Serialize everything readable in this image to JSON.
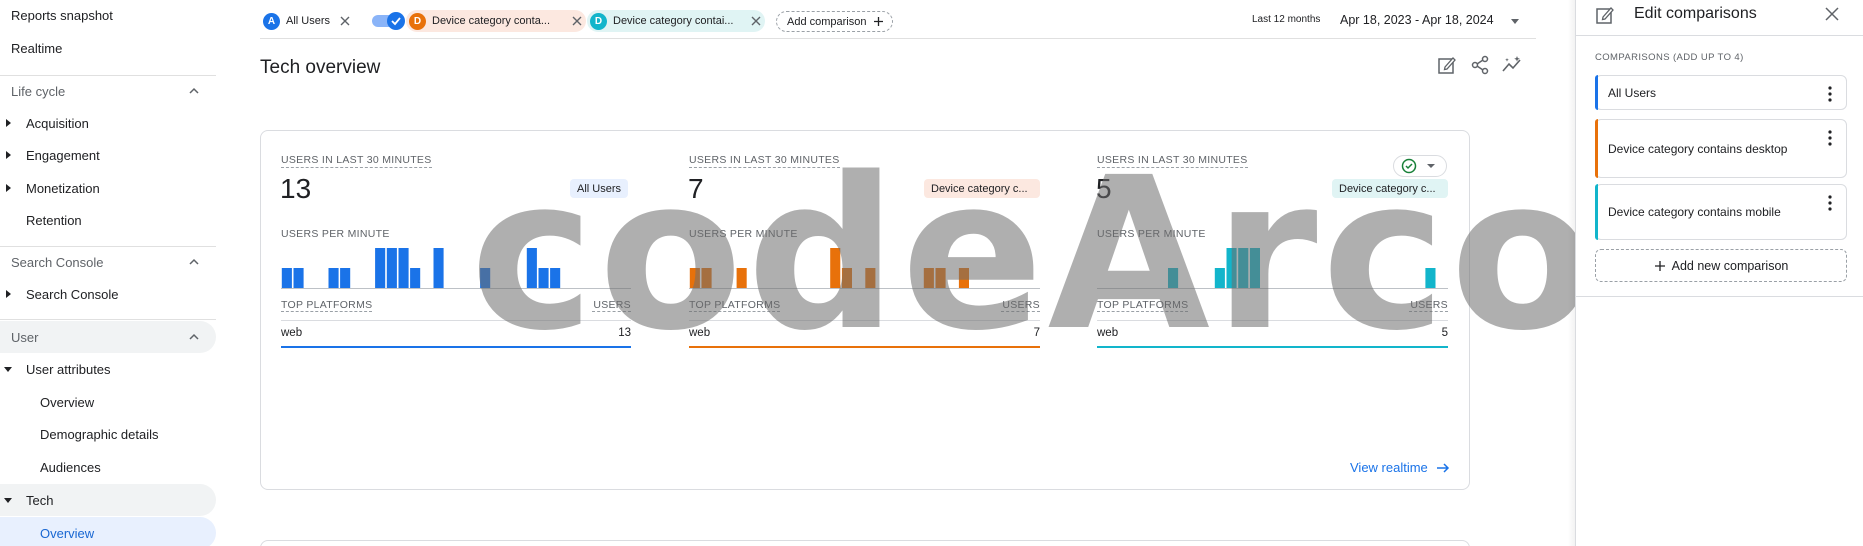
{
  "sidebar": {
    "top_items": [
      "Reports snapshot",
      "Realtime"
    ],
    "life_cycle": {
      "title": "Life cycle",
      "items": [
        "Acquisition",
        "Engagement",
        "Monetization",
        "Retention"
      ]
    },
    "search_console": {
      "title": "Search Console",
      "items": [
        "Search Console"
      ]
    },
    "user": {
      "title": "User",
      "user_attributes": "User attributes",
      "user_attributes_items": [
        "Overview",
        "Demographic details",
        "Audiences"
      ],
      "tech": "Tech",
      "tech_items": [
        "Overview"
      ]
    }
  },
  "topbar": {
    "chips": [
      {
        "badge": "A",
        "label": "All Users",
        "color": "#1a73e8"
      },
      {
        "badge": "D",
        "label": "Device category conta...",
        "color": "#e8710a"
      },
      {
        "badge": "D",
        "label": "Device category contai...",
        "color": "#12b5cb"
      }
    ],
    "add_comparison": "Add comparison",
    "date_label": "Last 12 months",
    "date_range": "Apr 18, 2023 - Apr 18, 2024"
  },
  "page": {
    "title": "Tech overview"
  },
  "card": {
    "columns": [
      {
        "label": "USERS IN LAST 30 MINUTES",
        "value": "13",
        "segment": "All Users",
        "segment_bg": "#e8f0fe",
        "segment_fg": "#202124",
        "color": "#1a73e8",
        "per_minute": "USERS PER MINUTE",
        "bars": [
          1,
          1,
          0,
          0,
          1,
          1,
          0,
          0,
          2,
          2,
          2,
          1,
          0,
          2,
          0,
          0,
          0,
          1,
          0,
          0,
          0,
          2,
          1,
          1,
          0,
          0,
          0,
          0,
          0,
          0
        ],
        "platforms_header": "TOP PLATFORMS",
        "users_header": "USERS",
        "platform": "web",
        "platform_value": "13"
      },
      {
        "label": "USERS IN LAST 30 MINUTES",
        "value": "7",
        "segment": "Device category c...",
        "segment_bg": "#fce8e0",
        "segment_fg": "#202124",
        "color": "#e8710a",
        "per_minute": "USERS PER MINUTE",
        "bars": [
          1,
          1,
          0,
          0,
          1,
          0,
          0,
          0,
          0,
          0,
          0,
          0,
          2,
          1,
          0,
          1,
          0,
          0,
          0,
          0,
          1,
          1,
          0,
          1,
          0,
          0,
          0,
          0,
          0,
          0
        ],
        "platforms_header": "TOP PLATFORMS",
        "users_header": "USERS",
        "platform": "web",
        "platform_value": "7"
      },
      {
        "label": "USERS IN LAST 30 MINUTES",
        "value": "5",
        "segment": "Device category c...",
        "segment_bg": "#e0f4f4",
        "segment_fg": "#202124",
        "color": "#12b5cb",
        "per_minute": "USERS PER MINUTE",
        "bars": [
          0,
          0,
          0,
          0,
          0,
          0,
          1,
          0,
          0,
          0,
          1,
          2,
          2,
          2,
          0,
          0,
          0,
          0,
          0,
          0,
          0,
          0,
          0,
          0,
          0,
          0,
          0,
          0,
          1,
          0
        ],
        "platforms_header": "TOP PLATFORMS",
        "users_header": "USERS",
        "platform": "web",
        "platform_value": "5"
      }
    ],
    "view_realtime": "View realtime"
  },
  "panel": {
    "title": "Edit comparisons",
    "subtitle": "COMPARISONS (ADD UP TO 4)",
    "comparisons": [
      {
        "label": "All Users",
        "color": "#1a73e8"
      },
      {
        "label": "Device category contains desktop",
        "color": "#e8710a"
      },
      {
        "label": "Device category contains mobile",
        "color": "#12b5cb"
      }
    ],
    "add_new": "Add new comparison"
  },
  "watermark": "codeArco",
  "colors": {
    "accent": "#1a73e8",
    "orange": "#e8710a",
    "teal": "#12b5cb",
    "check_green": "#188038"
  }
}
